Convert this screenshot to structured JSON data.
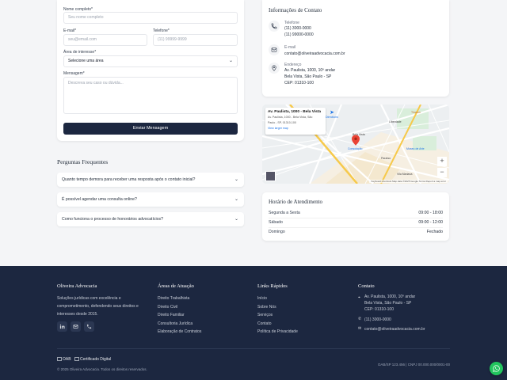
{
  "form": {
    "name_label": "Nome completo*",
    "name_placeholder": "Seu nome completo",
    "email_label": "E-mail*",
    "email_placeholder": "seu@email.com",
    "phone_label": "Telefone*",
    "phone_placeholder": "(11) 99999-9999",
    "area_label": "Área de interesse*",
    "area_selected": "Selecione uma área",
    "message_label": "Mensagem*",
    "message_placeholder": "Descreva seu caso ou dúvida...",
    "submit_label": "Enviar Mensagem"
  },
  "faq": {
    "title": "Perguntas Frequentes",
    "items": [
      {
        "question": "Quanto tempo demora para receber uma resposta após o contato inicial?"
      },
      {
        "question": "É possível agendar uma consulta online?"
      },
      {
        "question": "Como funciona o processo de honorários advocatícios?"
      }
    ]
  },
  "contact": {
    "title": "Informações de Contato",
    "phone_label": "Telefone",
    "phone_1": "(11) 3000-0000",
    "phone_2": "(11) 99000-0000",
    "email_label": "E-mail",
    "email_value": "contato@oliveiraadvocacia.com.br",
    "address_label": "Endereço",
    "address_1": "Av. Paulista, 1000, 10º andar",
    "address_2": "Bela Vista, São Paulo - SP",
    "address_3": "CEP: 01310-100"
  },
  "map": {
    "place_title": "Av. Paulista, 1000 - Bela Vista",
    "place_address_1": "Av. Paulista, 1000 - Bela Vista, São",
    "place_address_2": "Paulo - SP, 01310-100",
    "directions_label": "Directions",
    "view_larger": "View larger map",
    "footer": "Keyboard shortcuts  Map data ©2025 Google  Terms  Report a map error",
    "zoom_in": "+",
    "zoom_out": "−",
    "labels": [
      "Bela Vista",
      "Liberdade",
      "Trianon",
      "Consolação",
      "Paraíso",
      "Museu de Arte",
      "Vila Mariana"
    ]
  },
  "hours": {
    "title": "Horário de Atendimento",
    "rows": [
      {
        "day": "Segunda a Sexta",
        "time": "09:00 - 18:00"
      },
      {
        "day": "Sábado",
        "time": "09:00 - 12:00"
      },
      {
        "day": "Domingo",
        "time": "Fechado"
      }
    ]
  },
  "footer": {
    "brand": "Oliveira Advocacia",
    "about_1": "Soluções jurídicas com excelência e",
    "about_2": "comprometimento, defendendo seus direitos e",
    "about_3": "interesses desde 2015.",
    "areas_title": "Áreas de Atuação",
    "areas": [
      "Direito Trabalhista",
      "Direito Civil",
      "Direito Familiar",
      "Consultoria Jurídica",
      "Elaboração de Contratos"
    ],
    "links_title": "Links Rápidos",
    "links": [
      "Início",
      "Sobre Nós",
      "Serviços",
      "Contato",
      "Política de Privacidade"
    ],
    "contact_title": "Contato",
    "contact_address_1": "Av. Paulista, 1000, 10º andar",
    "contact_address_2": "Bela Vista, São Paulo - SP",
    "contact_address_3": "CEP: 01310-100",
    "contact_phone": "(11) 3000-0000",
    "contact_email": "contato@oliveiraadvocacia.com.br",
    "badge_oab": "OAB",
    "badge_cert": "Certificado Digital",
    "copyright": "© 2025 Oliveira Advocacia. Todos os direitos reservados.",
    "oab_reg": "OAB/SP 123.456 | CNPJ 00.000.000/0001-00"
  },
  "colors": {
    "navy": "#1c2740",
    "whatsapp": "#22c55e",
    "accent": "#ea4335"
  }
}
